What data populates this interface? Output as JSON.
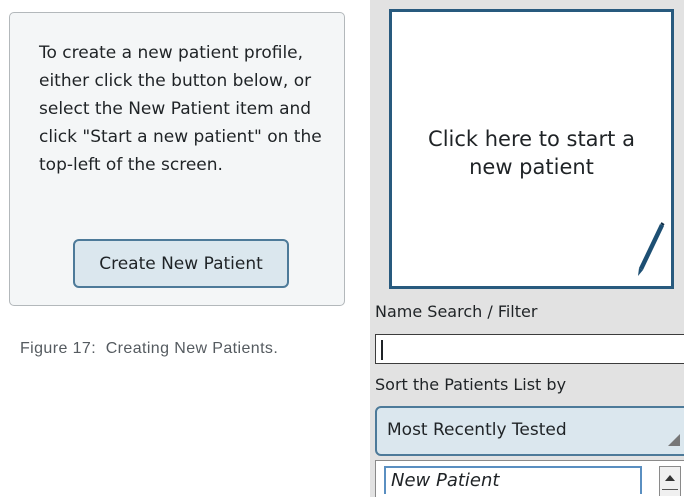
{
  "info": {
    "text": "To create a new patient profile, either click the button below, or select the New Patient item and click \"Start a new patient\" on the top-left of the screen.",
    "button_label": "Create New Patient"
  },
  "caption": "Figure 17:  Creating New Patients.",
  "panel": {
    "start_tile_text": "Click here to start a new patient",
    "start_tile_icon": "pencil-icon",
    "search_label": "Name Search / Filter",
    "search_value": "",
    "sort_label": "Sort the Patients List by",
    "sort_value": "Most Recently Tested",
    "list_items": [
      "New Patient"
    ]
  },
  "colors": {
    "accent": "#285a7e",
    "button_fill": "#dbe7ee",
    "button_border": "#4d7a99",
    "panel_bg": "#e2e2e2"
  }
}
